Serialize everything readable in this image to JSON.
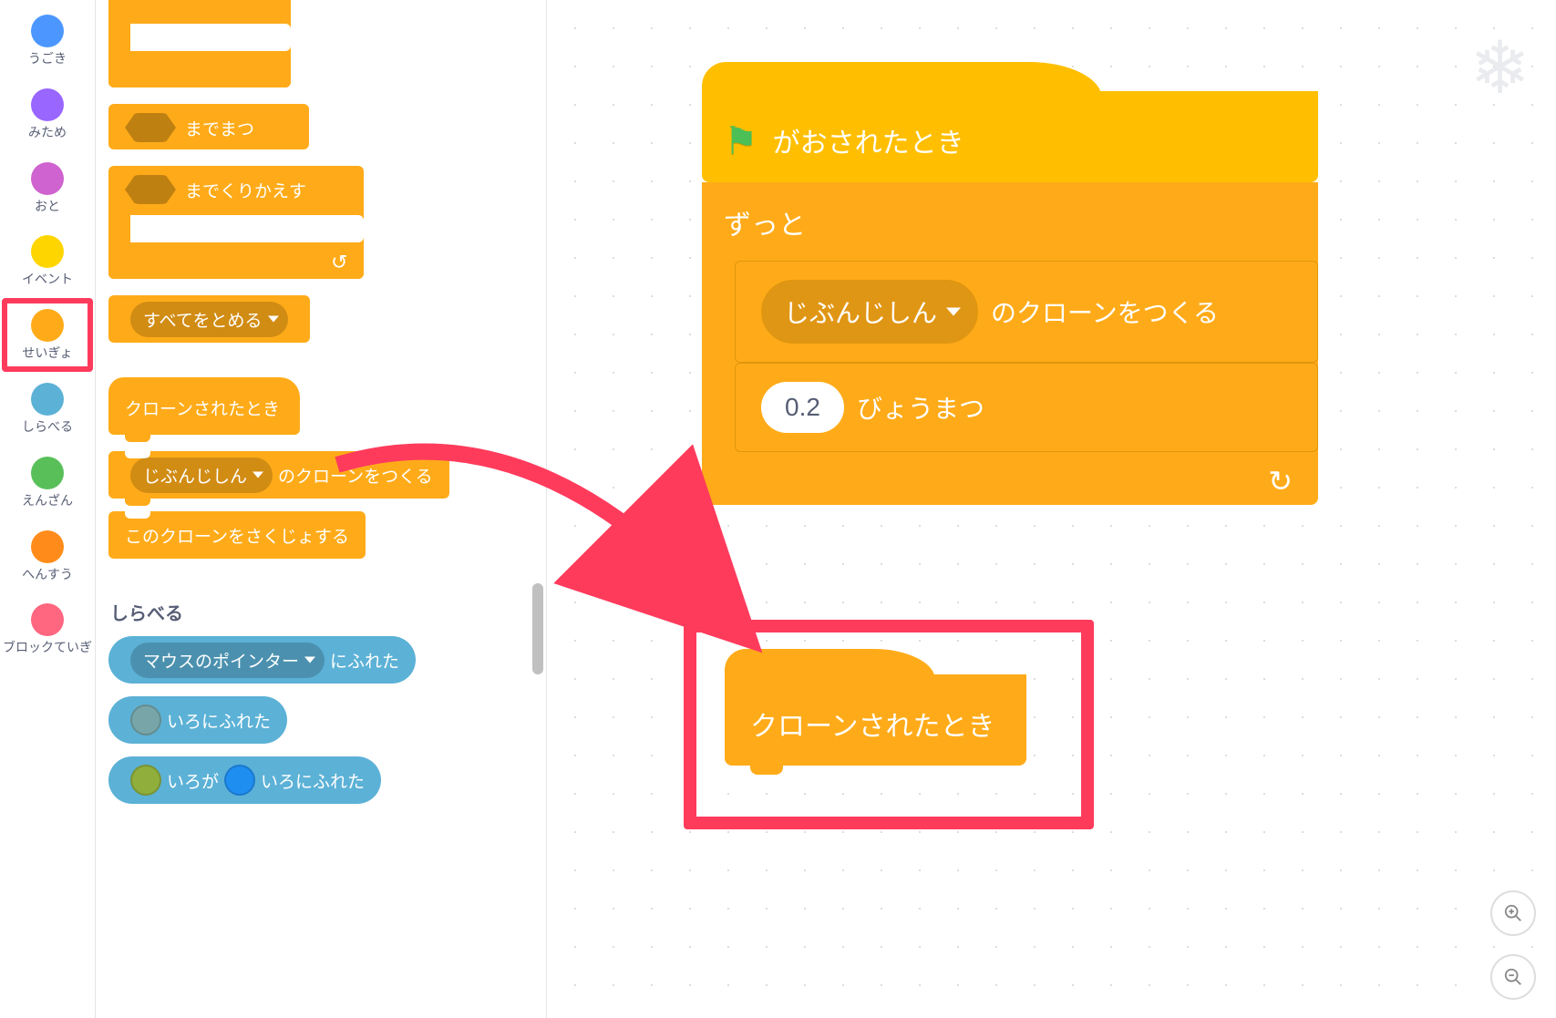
{
  "categories": [
    {
      "id": "motion",
      "label": "うごき",
      "color": "#4c97ff"
    },
    {
      "id": "looks",
      "label": "みため",
      "color": "#9966ff"
    },
    {
      "id": "sound",
      "label": "おと",
      "color": "#cf63cf"
    },
    {
      "id": "events",
      "label": "イベント",
      "color": "#ffd500"
    },
    {
      "id": "control",
      "label": "せいぎょ",
      "color": "#ffab19",
      "highlighted": true
    },
    {
      "id": "sensing",
      "label": "しらべる",
      "color": "#5cb1d6"
    },
    {
      "id": "operators",
      "label": "えんざん",
      "color": "#59c059"
    },
    {
      "id": "variables",
      "label": "へんすう",
      "color": "#ff8c1a"
    },
    {
      "id": "myblocks",
      "label": "ブロックていぎ",
      "color": "#ff6680"
    }
  ],
  "palette": {
    "control": {
      "if_label": "",
      "wait_until": "までまつ",
      "repeat_until": "までくりかえす",
      "stop_all": "すべてをとめる",
      "when_clone": "クローンされたとき",
      "create_clone_prefix": "じぶんじしん",
      "create_clone_suffix": "のクローンをつくる",
      "delete_clone": "このクローンをさくじょする"
    },
    "sensing_title": "しらべる",
    "sensing": {
      "touching_prefix": "マウスのポインター",
      "touching_suffix": "にふれた",
      "touching_color_label": "いろにふれた",
      "color_touching_color_a": "いろが",
      "color_touching_color_b": "いろにふれた",
      "color_a": "#8fae3c",
      "color_b": "#1f8ef1",
      "touch_color_swatch": "#77a5a8"
    }
  },
  "canvas": {
    "script1": {
      "hat_label": "がおされたとき",
      "forever_label": "ずっと",
      "clone_prefix": "じぶんじしん",
      "clone_suffix": "のクローンをつくる",
      "wait_value": "0.2",
      "wait_label": "びょうまつ"
    },
    "script2": {
      "when_clone": "クローンされたとき"
    }
  }
}
